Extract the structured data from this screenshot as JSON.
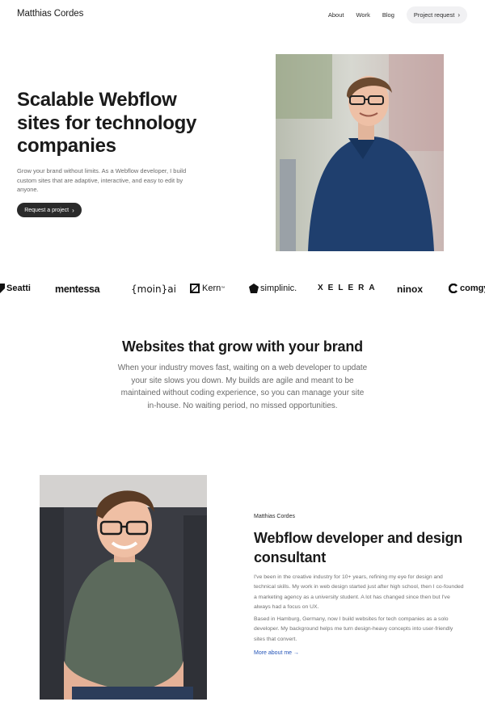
{
  "nav": {
    "brand": "Matthias Cordes",
    "links": [
      "About",
      "Work",
      "Blog"
    ],
    "cta_label": "Project request",
    "cta_icon": "chevron-right-icon"
  },
  "hero": {
    "title": "Scalable Webflow sites for technology companies",
    "subtitle": "Grow your brand without limits. As a Webflow developer, I build custom sites that are adaptive, interactive, and easy to edit by anyone.",
    "cta_label": "Request a project",
    "cta_icon": "chevron-right-icon"
  },
  "logos": [
    "Seatti",
    "mentessa",
    "{moin}ai",
    "Kern",
    "simplinic.",
    "XELERA",
    "ninox",
    "comgy"
  ],
  "section_brand": {
    "title": "Websites that grow with your brand",
    "body": "When your industry moves fast, waiting on a web developer to update your site slows you down. My builds are agile and meant to be maintained without coding experience, so you can manage your site in-house. No waiting period, no missed opportunities."
  },
  "about": {
    "eyebrow": "Matthias Cordes",
    "title": "Webflow developer and design consultant",
    "p1": "I've been in the creative industry for 10+ years, refining my eye for design and technical skills. My work in web design started just after high school, then I co-founded a marketing agency as a university student. A lot has changed since then but I've always had a focus on UX.",
    "p2": "Based in Hamburg, Germany, now I build websites for tech companies as a solo developer. My background helps me turn design-heavy concepts into user-friendly sites that convert.",
    "link_label": "More about me →"
  },
  "colors": {
    "text": "#1a1a1a",
    "muted": "#6a6a6a",
    "button_dark": "#2a2a2a",
    "pill_bg": "#f1f1f3",
    "link": "#2454b8",
    "shirt_blue": "#1f3f6e"
  }
}
